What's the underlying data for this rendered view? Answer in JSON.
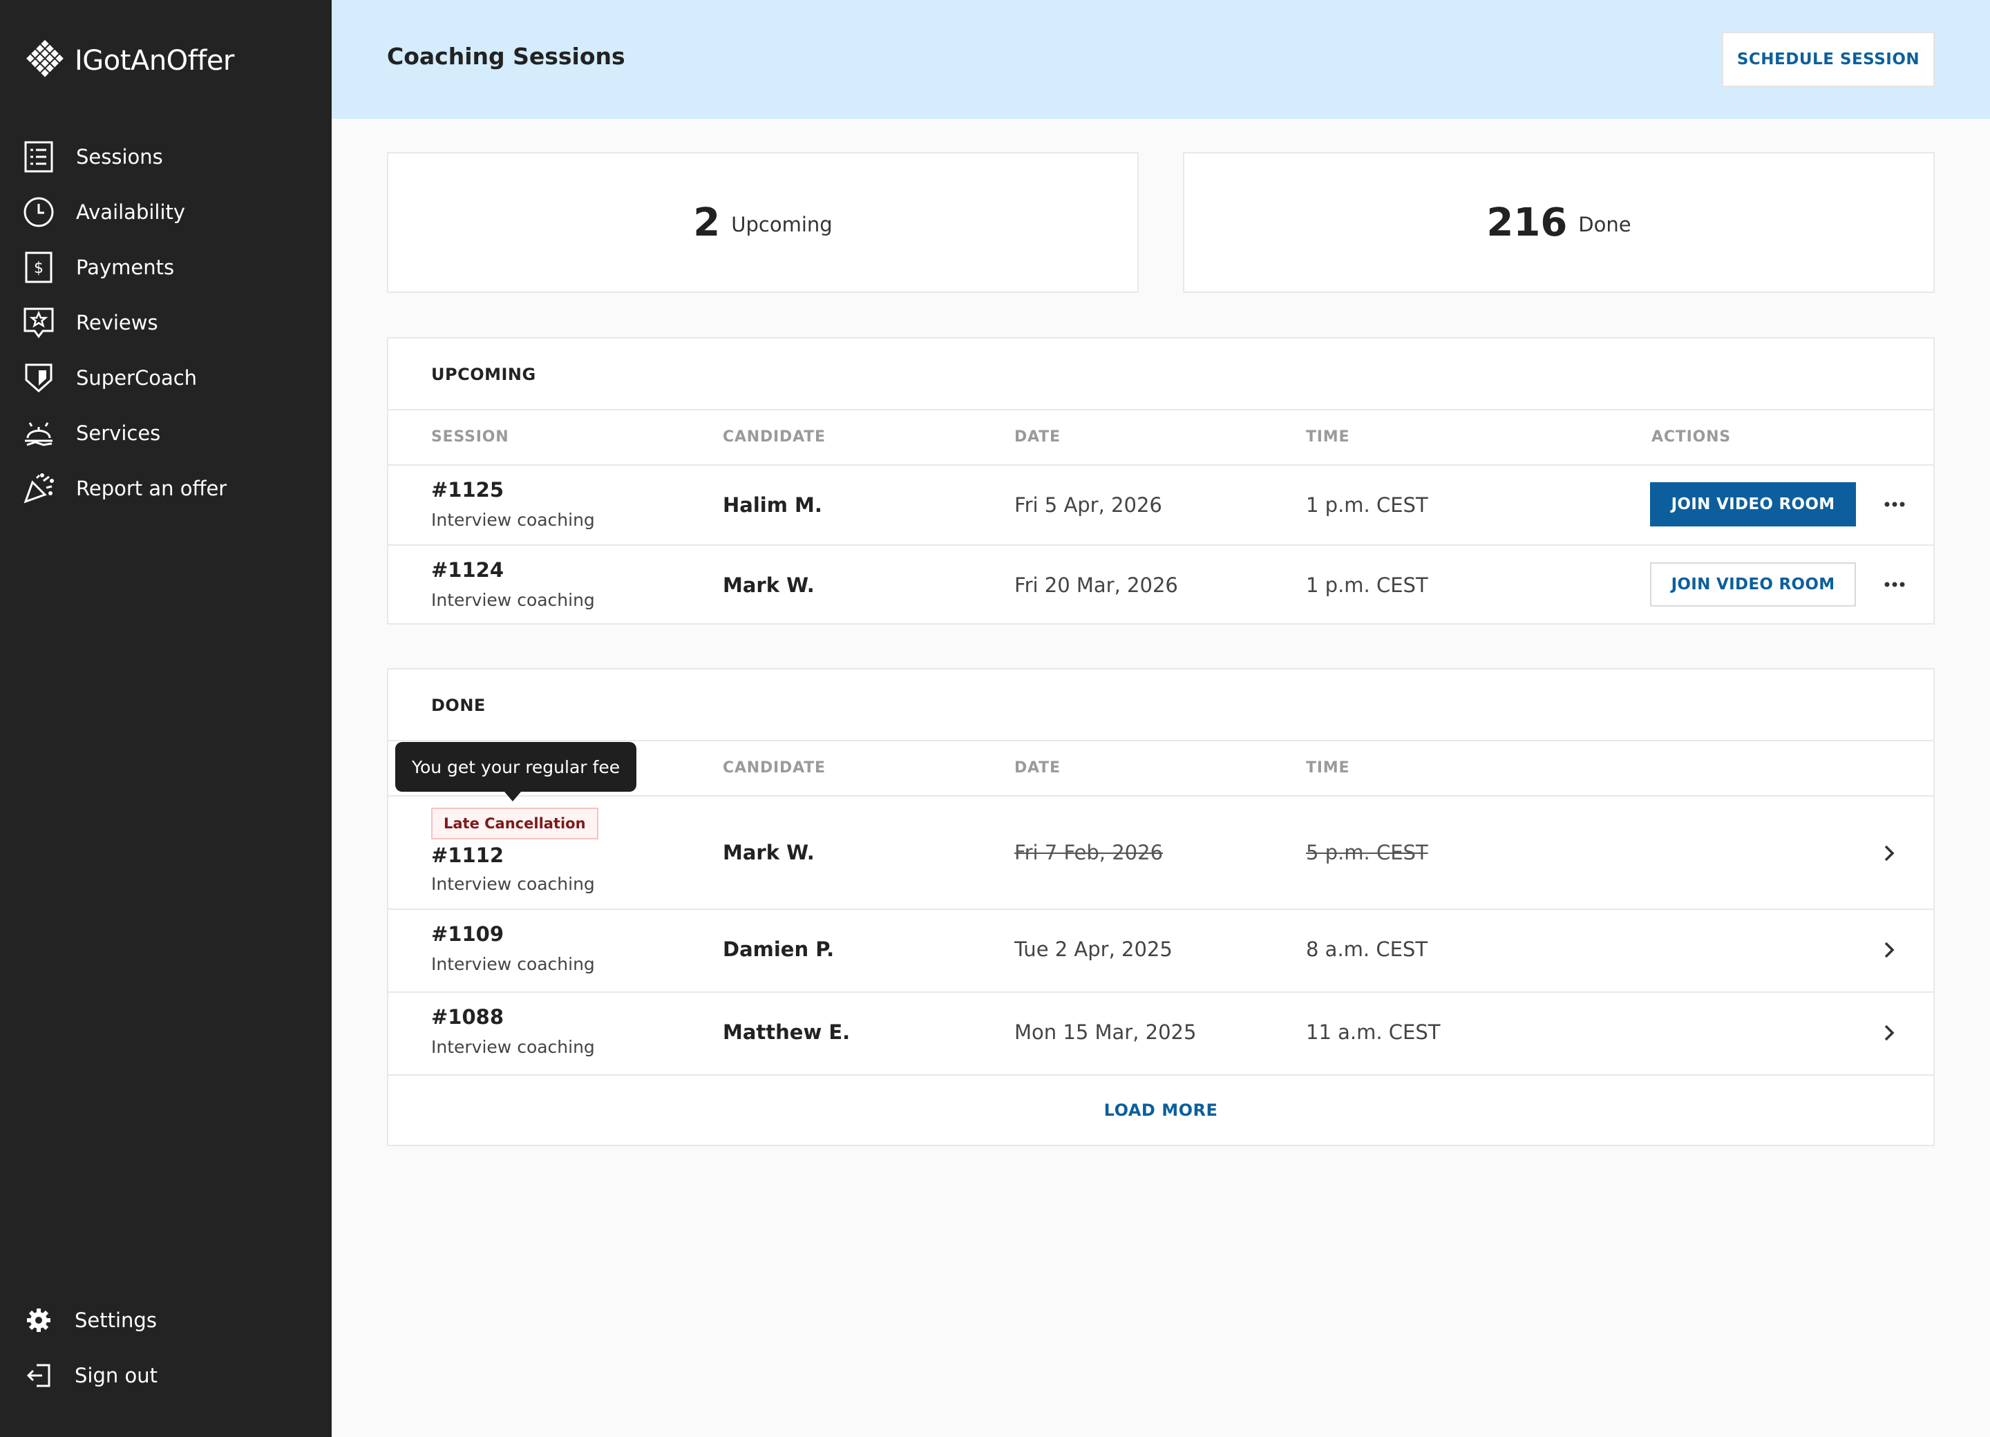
{
  "brand": {
    "name": "IGotAnOffer"
  },
  "nav": {
    "items": [
      {
        "label": "Sessions",
        "icon": "list-icon"
      },
      {
        "label": "Availability",
        "icon": "clock-icon"
      },
      {
        "label": "Payments",
        "icon": "dollar-icon"
      },
      {
        "label": "Reviews",
        "icon": "star-icon"
      },
      {
        "label": "SuperCoach",
        "icon": "shield-icon"
      },
      {
        "label": "Services",
        "icon": "services-icon"
      },
      {
        "label": "Report an offer",
        "icon": "party-icon"
      }
    ],
    "bottom": [
      {
        "label": "Settings",
        "icon": "gear-icon"
      },
      {
        "label": "Sign out",
        "icon": "sign-out-icon"
      }
    ]
  },
  "header": {
    "title": "Coaching Sessions",
    "schedule_label": "SCHEDULE SESSION"
  },
  "stats": {
    "upcoming": {
      "count": "2",
      "label": "Upcoming"
    },
    "done": {
      "count": "216",
      "label": "Done"
    }
  },
  "upcoming": {
    "title": "UPCOMING",
    "columns": [
      "SESSION",
      "CANDIDATE",
      "DATE",
      "TIME",
      "ACTIONS"
    ],
    "rows": [
      {
        "id": "#1125",
        "type": "Interview coaching",
        "candidate": "Halim M.",
        "date": "Fri 5 Apr, 2026",
        "time": "1 p.m. CEST",
        "action": "JOIN VIDEO ROOM"
      },
      {
        "id": "#1124",
        "type": "Interview coaching",
        "candidate": "Mark W.",
        "date": "Fri 20 Mar, 2026",
        "time": "1 p.m. CEST",
        "action": "JOIN VIDEO ROOM"
      }
    ]
  },
  "done": {
    "title": "DONE",
    "columns": [
      "CANDIDATE",
      "DATE",
      "TIME"
    ],
    "tooltip": "You get your regular fee",
    "badge": "Late Cancellation",
    "rows": [
      {
        "id": "#1112",
        "type": "Interview coaching",
        "candidate": "Mark W.",
        "date": "Fri 7 Feb, 2026",
        "time": "5 p.m. CEST"
      },
      {
        "id": "#1109",
        "type": "Interview coaching",
        "candidate": "Damien P.",
        "date": "Tue 2 Apr, 2025",
        "time": "8 a.m. CEST"
      },
      {
        "id": "#1088",
        "type": "Interview coaching",
        "candidate": "Matthew E.",
        "date": "Mon 15 Mar, 2025",
        "time": "11 a.m. CEST"
      }
    ],
    "load_more": "LOAD MORE"
  },
  "colors": {
    "sidebar": "#232323",
    "header": "#d4ecfb",
    "accent": "#0c5f9c",
    "badge_bg": "#fff3f3",
    "badge_text": "#7b1a1a"
  }
}
